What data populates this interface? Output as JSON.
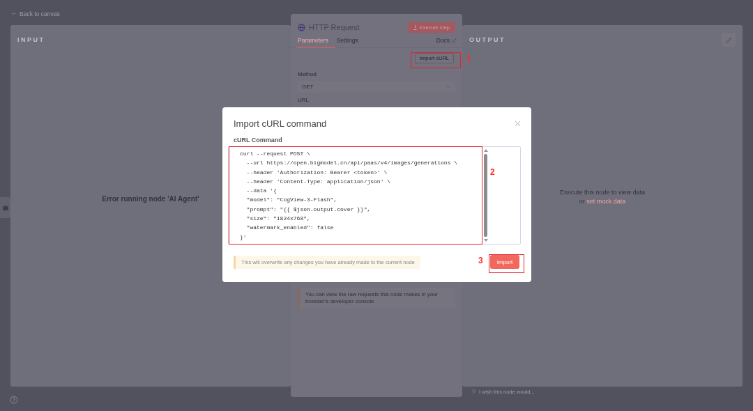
{
  "header": {
    "back_link": "Back to canvas"
  },
  "input_panel": {
    "title": "INPUT",
    "message": "Error running node 'AI Agent'"
  },
  "node_panel": {
    "title": "HTTP Request",
    "execute_button": "Execute step",
    "tabs": [
      {
        "label": "Parameters",
        "selected": true
      },
      {
        "label": "Settings",
        "selected": false
      }
    ],
    "docs_link": "Docs",
    "import_button": "Import cURL",
    "method": {
      "label": "Method",
      "value": "GET"
    },
    "url": {
      "label": "URL"
    },
    "notice": "You can view the raw requests this node makes in your browser's developer console"
  },
  "output_panel": {
    "title": "OUTPUT",
    "message": "Execute this node to view data",
    "mock_prefix": "or",
    "mock_link": "set mock data"
  },
  "feedback": {
    "placeholder": "I wish this node would..."
  },
  "modal": {
    "title": "Import cURL command",
    "field_label": "cURL Command",
    "command": "curl --request POST \\\n  --url https://open.bigmodel.cn/api/paas/v4/images/generations \\\n  --header 'Authorization: Bearer <token>' \\\n  --header 'Content-Type: application/json' \\\n  --data '{\n  \"model\": \"CogView-3-Flash\",\n  \"prompt\": \"{{ $json.output.cover }}\",\n  \"size\": \"1824x768\",\n  \"watermark_enabled\": false\n}'",
    "warning": "This will overwrite any changes you have already made to the current node",
    "import_button": "Import"
  },
  "annotations": [
    {
      "label": "1"
    },
    {
      "label": "2"
    },
    {
      "label": "3"
    }
  ]
}
